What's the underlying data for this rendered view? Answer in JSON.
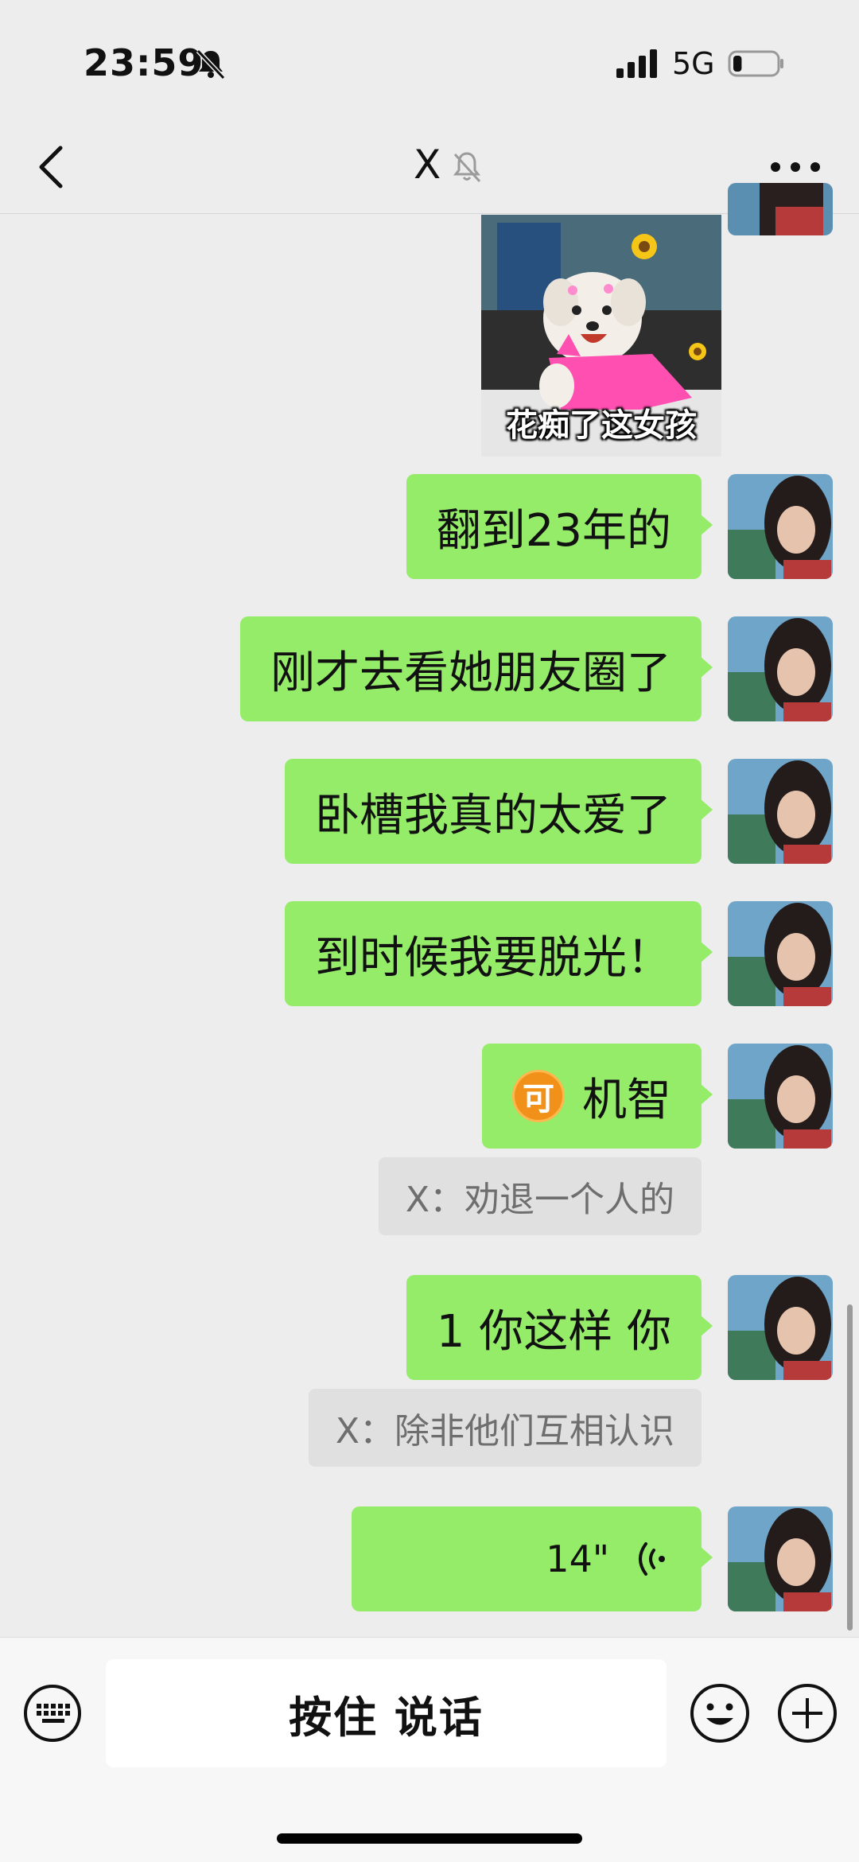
{
  "status_bar": {
    "time": "23:59",
    "network": "5G",
    "battery_level": 0.2
  },
  "header": {
    "title": "X"
  },
  "messages": {
    "sticker_caption": "花痴了这女孩",
    "m1": "翻到23年的",
    "m2": "刚才去看她朋友圈了",
    "m3": "卧槽我真的太爱了",
    "m4": "到时候我要脱光！",
    "m5_emoji": "可",
    "m5": "机智",
    "q1": "X：劝退一个人的",
    "m6": "1 你这样 你",
    "q2": "X：除非他们互相认识",
    "voice_duration": "14\""
  },
  "input_bar": {
    "hold_to_talk": "按住 说话"
  },
  "colors": {
    "bubble": "#95ec69",
    "background": "#ededed",
    "quote": "#e0e0e0"
  },
  "icons": [
    "bell-off-icon",
    "signal-icon",
    "battery-icon",
    "back-chevron-icon",
    "mute-icon",
    "more-dots-icon",
    "voice-wave-icon",
    "keyboard-icon",
    "emoji-icon",
    "plus-icon"
  ]
}
